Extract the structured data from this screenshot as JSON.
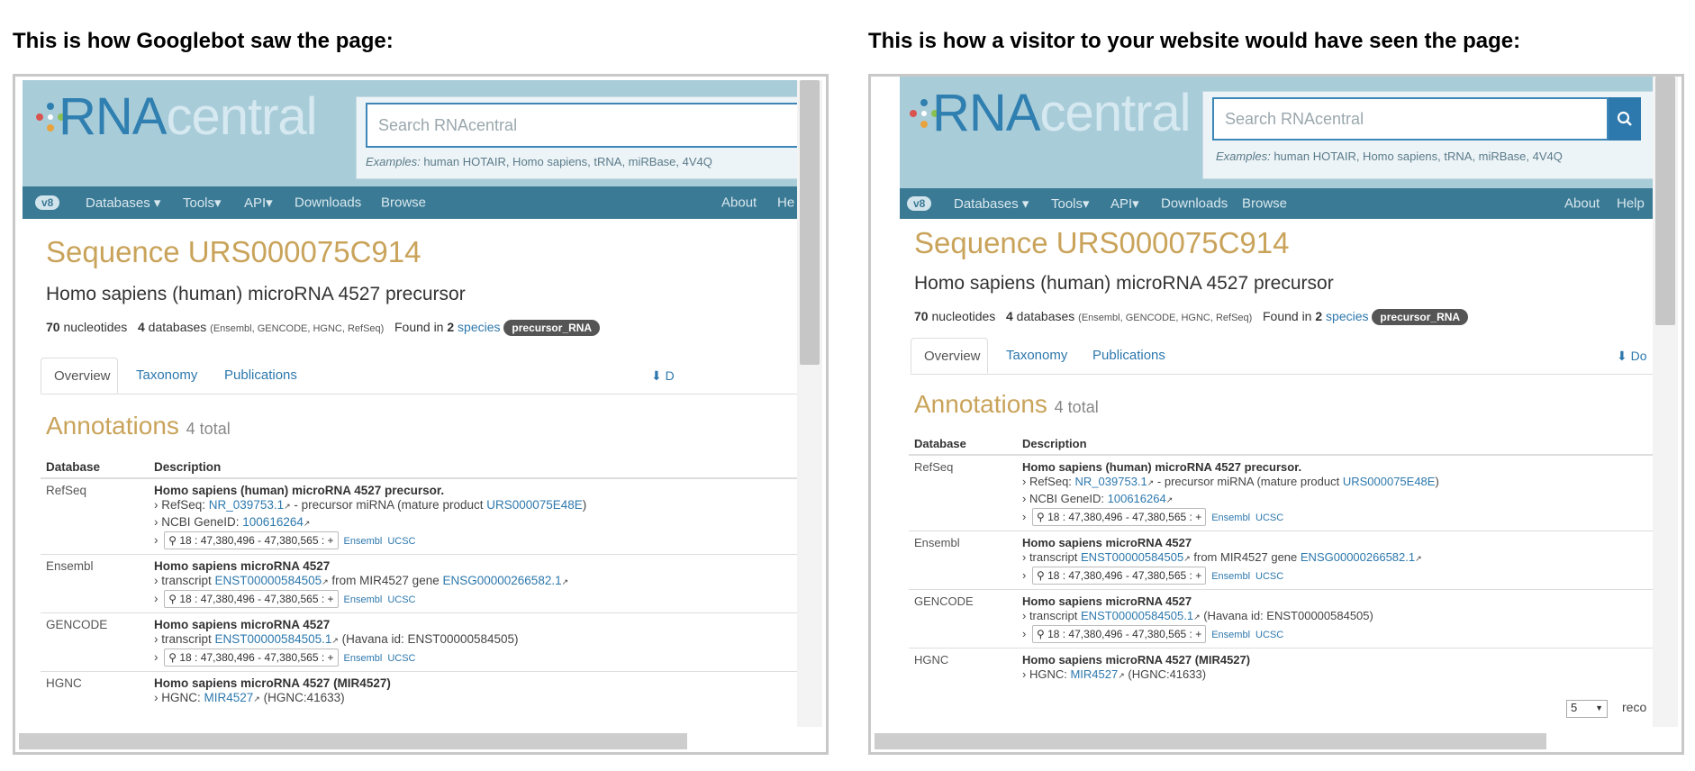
{
  "captions": {
    "left": "This is how Googlebot saw the page:",
    "right": "This is how a visitor to your website would have seen the page:"
  },
  "site": {
    "logo_rna": "RNA",
    "logo_central": "central",
    "search_placeholder": "Search RNAcentral",
    "examples_label": "Examples:",
    "examples": "human HOTAIR, Homo sapiens, tRNA, miRBase, 4V4Q",
    "version_badge": "v8",
    "nav": {
      "databases": "Databases ▾",
      "tools": "Tools▾",
      "api": "API▾",
      "downloads": "Downloads",
      "browse": "Browse",
      "about": "About",
      "help_left": "He",
      "help_right": "Help"
    }
  },
  "sequence": {
    "title": "Sequence URS000075C914",
    "description": "Homo sapiens (human) microRNA 4527 precursor",
    "nucleotides_count": "70",
    "nucleotides_label": "nucleotides",
    "databases_count": "4",
    "databases_label": "databases",
    "databases_list": "(Ensembl, GENCODE, HGNC, RefSeq)",
    "found_in": "Found in",
    "species_count": "2",
    "species_label": "species",
    "rna_type": "precursor_RNA"
  },
  "tabs": {
    "overview": "Overview",
    "taxonomy": "Taxonomy",
    "publications": "Publications",
    "download_left": "⬇ D",
    "download_right": "⬇ Do"
  },
  "annotations": {
    "title": "Annotations",
    "total": "4 total",
    "col_database": "Database",
    "col_description": "Description",
    "rows": [
      {
        "db": "RefSeq",
        "title": "Homo sapiens (human) microRNA 4527 precursor.",
        "l1_pre": "› RefSeq: ",
        "l1_link": "NR_039753.1",
        "l1_mid": " - precursor miRNA (mature product ",
        "l1_link2": "URS000075E48E",
        "l1_post": ")",
        "l2_pre": "› NCBI GeneID: ",
        "l2_link": "100616264",
        "loc": "⚲ 18 : 47,380,496 - 47,380,565 : +",
        "ensembl": "Ensembl",
        "ucsc": "UCSC"
      },
      {
        "db": "Ensembl",
        "title": "Homo sapiens microRNA 4527",
        "l1_pre": "› transcript ",
        "l1_link": "ENST00000584505",
        "l1_mid": " from MIR4527 gene ",
        "l1_link2": "ENSG00000266582.1",
        "loc": "⚲ 18 : 47,380,496 - 47,380,565 : +",
        "ensembl": "Ensembl",
        "ucsc": "UCSC"
      },
      {
        "db": "GENCODE",
        "title": "Homo sapiens microRNA 4527",
        "l1_pre": "› transcript ",
        "l1_link": "ENST00000584505.1",
        "l1_mid": " (Havana id: ENST00000584505)",
        "loc": "⚲ 18 : 47,380,496 - 47,380,565 : +",
        "ensembl": "Ensembl",
        "ucsc": "UCSC"
      },
      {
        "db": "HGNC",
        "title": "Homo sapiens microRNA 4527 (MIR4527)",
        "l1_pre": "› HGNC: ",
        "l1_link": "MIR4527",
        "l1_mid": " (HGNC:41633)"
      }
    ],
    "page_size": "5",
    "records_label": "reco"
  }
}
